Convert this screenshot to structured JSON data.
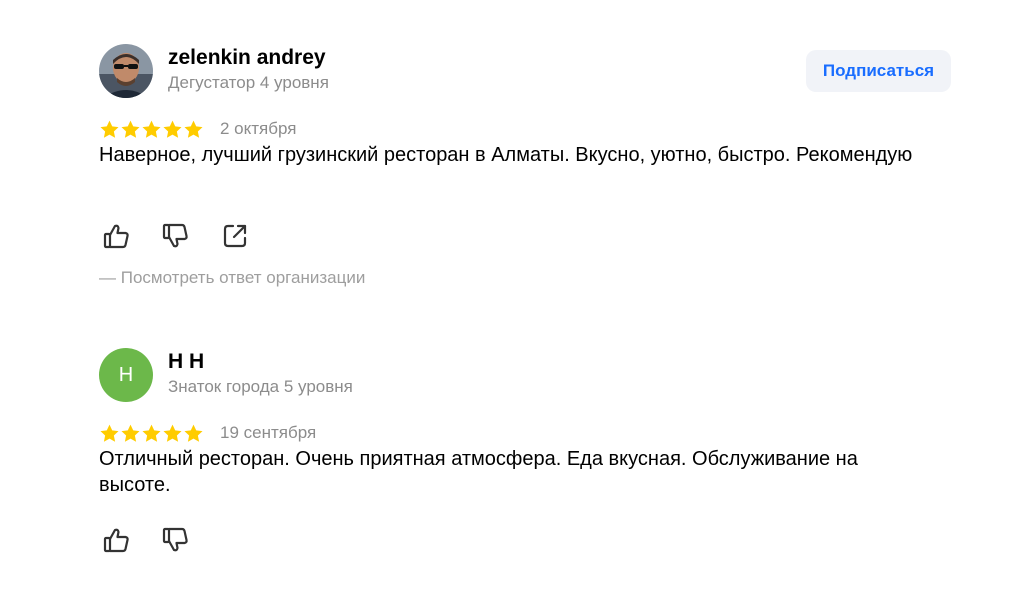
{
  "reviews": [
    {
      "author": {
        "name": "zelenkin andrey",
        "level": "Дегустатор 4 уровня",
        "avatar": "photo"
      },
      "subscribe_label": "Подписаться",
      "rating": 5,
      "date": "2 октября",
      "text": "Наверное, лучший грузинский ресторан в Алматы. Вкусно, уютно, быстро. Рекомендую",
      "actions": [
        "thumbs-up-icon",
        "thumbs-down-icon",
        "share-icon"
      ],
      "org_reply_label": "—  Посмотреть ответ организации"
    },
    {
      "author": {
        "name": "Н Н",
        "level": "Знаток города 5 уровня",
        "avatar_letter": "Н",
        "avatar_color": "#6cb84a"
      },
      "rating": 5,
      "date": "19 сентября",
      "text": "Отличный ресторан. Очень приятная атмосфера. Еда вкусная. Обслуживание на высоте.",
      "actions": [
        "thumbs-up-icon",
        "thumbs-down-icon"
      ]
    }
  ],
  "colors": {
    "star": "#fc0",
    "accent": "#196dff",
    "secondary_text": "#8c8c8c"
  }
}
